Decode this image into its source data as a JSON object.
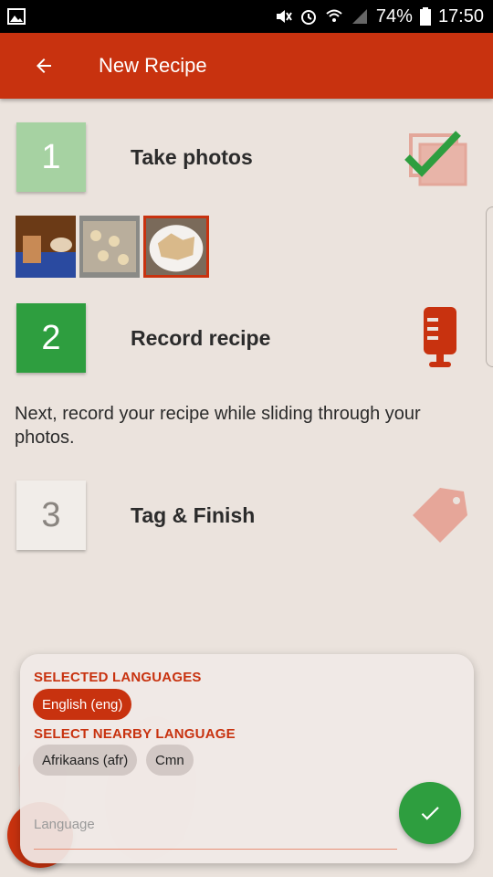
{
  "status_bar": {
    "battery": "74%",
    "time": "17:50"
  },
  "app_bar": {
    "title": "New Recipe"
  },
  "steps": [
    {
      "number": "1",
      "label": "Take photos",
      "color": "#a6d2a2",
      "icon": "photos-check-icon"
    },
    {
      "number": "2",
      "label": "Record recipe",
      "color": "#2e9e3f",
      "icon": "microphone-icon"
    },
    {
      "number": "3",
      "label": "Tag & Finish",
      "color": "#f1ede9",
      "icon": "tag-icon"
    }
  ],
  "description": "Next, record your recipe while sliding through your photos.",
  "language_sheet": {
    "selected_heading": "SELECTED LANGUAGES",
    "selected": [
      "English (eng)"
    ],
    "nearby_heading": "SELECT NEARBY LANGUAGE",
    "nearby": [
      "Afrikaans (afr)",
      "Cmn"
    ],
    "input_placeholder": "Language"
  },
  "colors": {
    "primary": "#c8320f",
    "accent_green": "#2e9e3f",
    "background": "#ebe3dd"
  }
}
